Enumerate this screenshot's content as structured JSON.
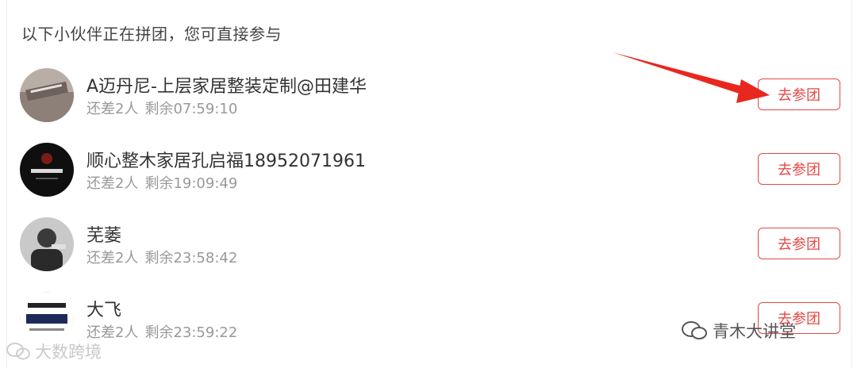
{
  "heading": "以下小伙伴正在拼团，您可直接参与",
  "join_label": "去参团",
  "groups": [
    {
      "name": "A迈丹尼-上层家居整装定制@田建华",
      "need": "还差2人",
      "remain": "剩余07:59:10"
    },
    {
      "name": "顺心整木家居孔启福18952071961",
      "need": "还差2人",
      "remain": "剩余19:09:49"
    },
    {
      "name": "芜萎",
      "need": "还差2人",
      "remain": "剩余23:58:42"
    },
    {
      "name": "大飞",
      "need": "还差2人",
      "remain": "剩余23:59:22"
    }
  ],
  "watermark_left": "大数跨境",
  "watermark_right": "青木大讲堂",
  "colors": {
    "accent": "#e34a45",
    "muted": "#999999",
    "text": "#333333"
  },
  "icons": {
    "watermark_icon": "wechat-icon",
    "pointer": "red-arrow"
  }
}
